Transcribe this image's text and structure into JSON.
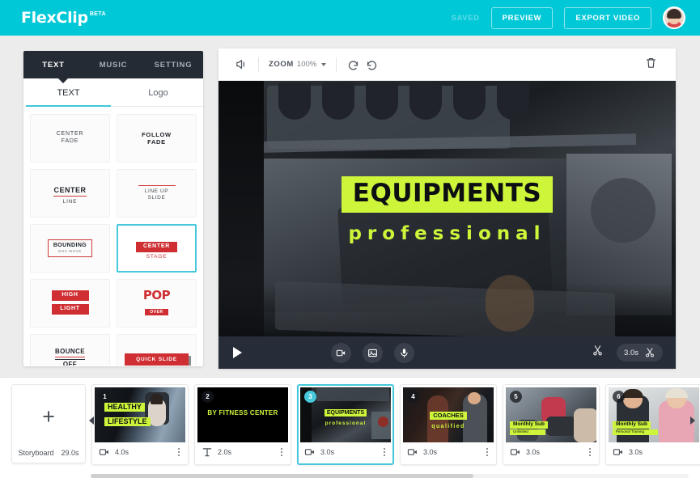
{
  "header": {
    "logo": "FlexClip",
    "logo_badge": "BETA",
    "saved_label": "SAVED",
    "preview_label": "PREVIEW",
    "export_label": "EXPORT VIDEO",
    "brand_color": "#00c8d7",
    "avatar_name": "user-avatar"
  },
  "sidebar": {
    "tabs": [
      {
        "label": "TEXT",
        "active": true
      },
      {
        "label": "MUSIC",
        "active": false
      },
      {
        "label": "SETTING",
        "active": false
      }
    ],
    "sub_tabs": [
      {
        "label": "TEXT",
        "active": true
      },
      {
        "label": "Logo",
        "active": false
      }
    ],
    "presets": [
      {
        "line1": "CENTER",
        "line2": "FADE",
        "style": "center-fade",
        "selected": false
      },
      {
        "line1": "FOLLOW",
        "line2": "FADE",
        "style": "follow-fade",
        "selected": false
      },
      {
        "line1": "CENTER",
        "line2": "LINE",
        "style": "center-line",
        "selected": false
      },
      {
        "line1": "LINE UP",
        "line2": "SLIDE",
        "style": "line-up-slide",
        "selected": false
      },
      {
        "line1": "BOUNDING",
        "line2": "BOX MOVE",
        "style": "bounding-box",
        "selected": false
      },
      {
        "line1": "CENTER",
        "line2": "STAGE",
        "style": "center-stage",
        "selected": true
      },
      {
        "line1": "HIGH",
        "line2": "LIGHT",
        "style": "high-light",
        "selected": false
      },
      {
        "line1": "POP",
        "line2": "OVER",
        "style": "pop-over",
        "selected": false
      },
      {
        "line1": "BOUNCE",
        "line2": "OFF",
        "style": "bounce-off",
        "selected": false
      },
      {
        "line1": "QUICK SLIDE",
        "line2": "",
        "style": "quick-slide",
        "selected": false
      }
    ]
  },
  "toolbar": {
    "mute_icon": "speaker-icon",
    "zoom_label": "ZOOM",
    "zoom_value": "100%",
    "undo_icon": "undo-icon",
    "redo_icon": "redo-icon",
    "delete_icon": "trash-icon"
  },
  "canvas": {
    "overlay_title": "EQUIPMENTS",
    "overlay_subtitle": "professional",
    "highlight_color": "#cdf53a",
    "text_color": "#0d0f12"
  },
  "player": {
    "play_icon": "play-icon",
    "add_video_icon": "video-icon",
    "add_image_icon": "image-icon",
    "record_icon": "microphone-icon",
    "split_icon": "scissors-icon",
    "duration": "3.0s",
    "trim_icon": "scissors-icon"
  },
  "timeline": {
    "storyboard_label": "Storyboard",
    "storyboard_duration": "29.0s",
    "add_label": "+",
    "clips": [
      {
        "number": "1",
        "duration": "4.0s",
        "type_icon": "video-icon",
        "caption_line1": "HEALTHY",
        "caption_line2": "LIFESTYLE",
        "selected": false
      },
      {
        "number": "2",
        "duration": "2.0s",
        "type_icon": "text-icon",
        "caption_line1": "BY FITNESS CENTER",
        "caption_line2": "",
        "selected": false
      },
      {
        "number": "3",
        "duration": "3.0s",
        "type_icon": "video-icon",
        "caption_line1": "EQUIPMENTS",
        "caption_line2": "professional",
        "selected": true
      },
      {
        "number": "4",
        "duration": "3.0s",
        "type_icon": "video-icon",
        "caption_line1": "COACHES",
        "caption_line2": "qualified",
        "selected": false
      },
      {
        "number": "5",
        "duration": "3.0s",
        "type_icon": "video-icon",
        "caption_line1": "Monthly Sub",
        "caption_line2": "Unlimited",
        "selected": false
      },
      {
        "number": "6",
        "duration": "3.0s",
        "type_icon": "video-icon",
        "caption_line1": "Monthly Sub",
        "caption_line2": "Personal Training",
        "selected": false
      }
    ]
  }
}
